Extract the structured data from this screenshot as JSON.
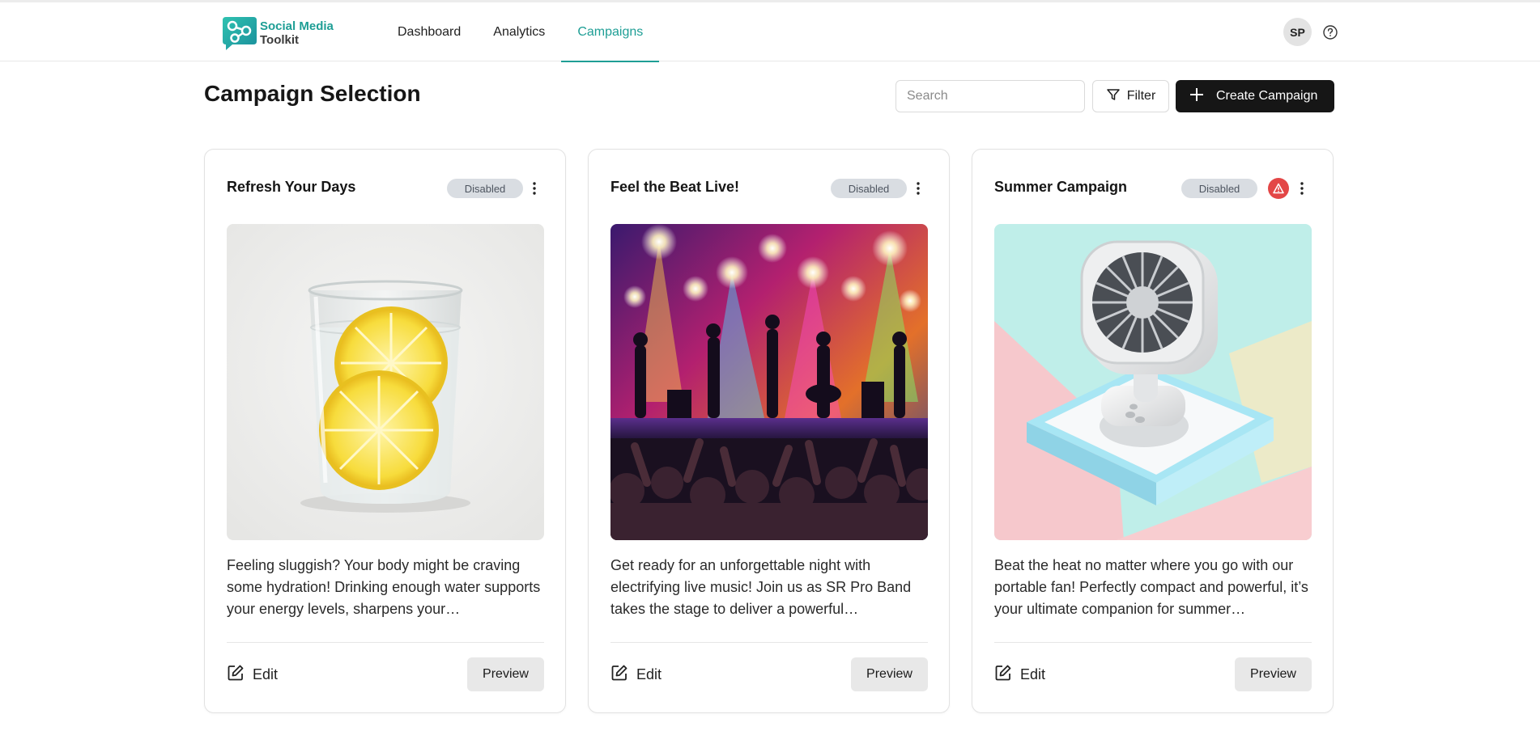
{
  "app": {
    "logo_line1": "Social Media",
    "logo_line2": "Toolkit",
    "logo_icon": "share-network-icon",
    "brand_color": "#1e9e95"
  },
  "nav": {
    "items": [
      {
        "label": "Dashboard",
        "active": false
      },
      {
        "label": "Analytics",
        "active": false
      },
      {
        "label": "Campaigns",
        "active": true
      }
    ]
  },
  "user": {
    "initials": "SP",
    "help_icon": "question-circle-icon"
  },
  "page": {
    "title": "Campaign Selection"
  },
  "toolbar": {
    "search_placeholder": "Search",
    "search_value": "",
    "filter_label": "Filter",
    "filter_icon": "funnel-icon",
    "create_label": "Create Campaign",
    "create_icon": "plus-icon"
  },
  "campaigns": [
    {
      "title": "Refresh Your Days",
      "status": "Disabled",
      "warning": false,
      "image": "glass of water with lemon slices",
      "description": "Feeling sluggish? Your body might be craving some hydration! Drinking enough water supports your energy levels, sharpens your…",
      "edit_label": "Edit",
      "preview_label": "Preview"
    },
    {
      "title": "Feel the Beat Live!",
      "status": "Disabled",
      "warning": false,
      "image": "live concert stage with band and crowd",
      "description": "Get ready for an unforgettable night with electrifying live music! Join us as SR Pro Band takes the stage to deliver a powerful…",
      "edit_label": "Edit",
      "preview_label": "Preview"
    },
    {
      "title": "Summer Campaign",
      "status": "Disabled",
      "warning": true,
      "image": "portable desk fan on pastel background",
      "description": "Beat the heat no matter where you go with our portable fan! Perfectly compact and powerful, it’s your ultimate companion for summer…",
      "edit_label": "Edit",
      "preview_label": "Preview"
    }
  ],
  "colors": {
    "badge_bg": "#d9dde2",
    "warning": "#e34646",
    "primary_button": "#161616"
  }
}
